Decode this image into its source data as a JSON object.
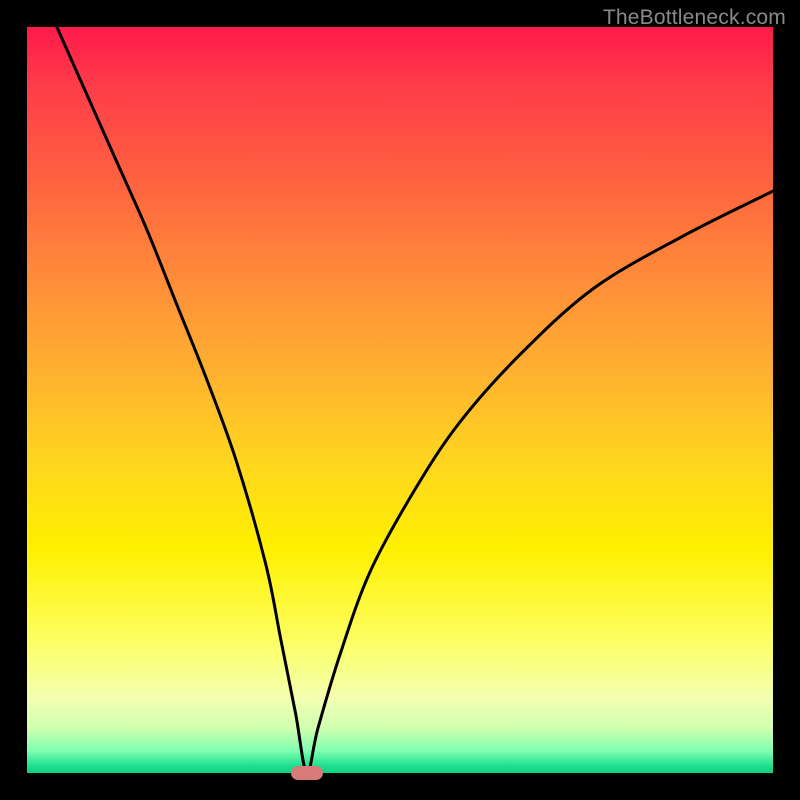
{
  "watermark": "TheBottleneck.com",
  "chart_data": {
    "type": "line",
    "title": "",
    "xlabel": "",
    "ylabel": "",
    "xlim": [
      0,
      100
    ],
    "ylim": [
      0,
      100
    ],
    "grid": false,
    "legend": false,
    "background_gradient": {
      "stops": [
        {
          "pos": 0,
          "color": "#ff1a4a"
        },
        {
          "pos": 0.5,
          "color": "#ffd520"
        },
        {
          "pos": 0.85,
          "color": "#fdff60"
        },
        {
          "pos": 1,
          "color": "#10d080"
        }
      ]
    },
    "series": [
      {
        "name": "bottleneck-curve",
        "note": "V-shaped curve; y = 0 at the minimum (marker), rising steeply on both sides. Values are percentages of plot height/width.",
        "x": [
          4,
          8,
          12,
          16,
          20,
          24,
          28,
          32,
          34,
          36,
          37.5,
          39,
          42,
          46,
          52,
          58,
          66,
          76,
          88,
          100
        ],
        "y": [
          100,
          91,
          82,
          73,
          63,
          53,
          42,
          28,
          18,
          8,
          0,
          6,
          16,
          27,
          38,
          47,
          56,
          65,
          72,
          78
        ]
      }
    ],
    "marker": {
      "name": "optimal-point",
      "x": 37.5,
      "y": 0,
      "color": "#d87a78"
    }
  }
}
